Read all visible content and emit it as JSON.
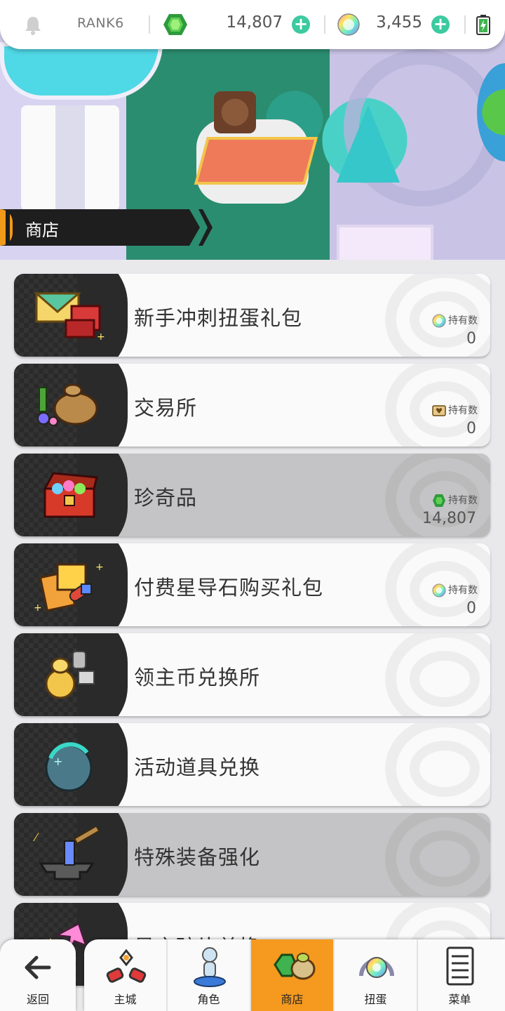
{
  "header": {
    "rank": "RANK6",
    "green_gems": "14,807",
    "rainbow_gems": "3,455"
  },
  "banner": {
    "section_title": "商店"
  },
  "shop_items": [
    {
      "title": "新手冲刺扭蛋礼包",
      "held_label": "持有数",
      "held_count": "0",
      "held_icon": "rainbow-gem-icon"
    },
    {
      "title": "交易所",
      "held_label": "持有数",
      "held_count": "0",
      "held_icon": "trade-ticket-icon"
    },
    {
      "title": "珍奇品",
      "held_label": "持有数",
      "held_count": "14,807",
      "held_icon": "green-gem-icon"
    },
    {
      "title": "付费星导石购买礼包",
      "held_label": "持有数",
      "held_count": "0",
      "held_icon": "rainbow-gem-icon"
    },
    {
      "title": "领主币兑换所"
    },
    {
      "title": "活动道具兑换"
    },
    {
      "title": "特殊装备强化"
    },
    {
      "title": "星之碎片兑换"
    }
  ],
  "nav": {
    "back": "返回",
    "items": [
      "主城",
      "角色",
      "商店",
      "扭蛋",
      "菜单"
    ],
    "active": "商店"
  },
  "colors": {
    "accent_orange": "#f59a1f",
    "plus_teal": "#3ccaa0",
    "green_gem": "#3fb34f",
    "card_dark": "#2a2a2a"
  }
}
